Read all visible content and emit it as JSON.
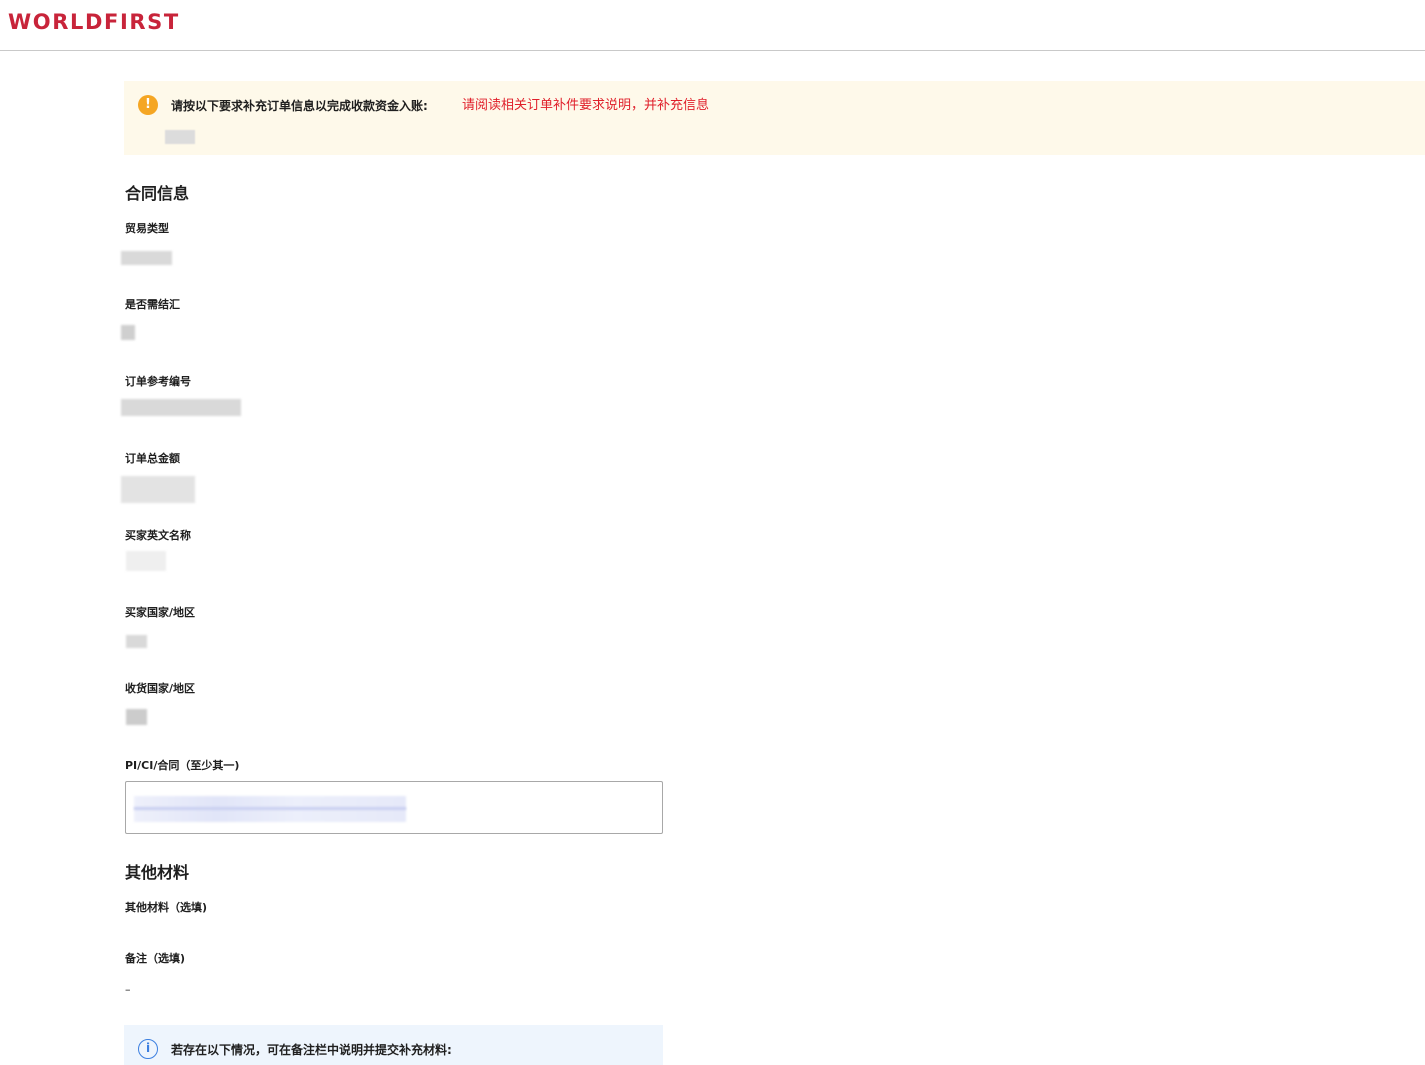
{
  "header": {
    "logo_text": "WORLDFIRST"
  },
  "notice": {
    "icon": "exclamation-circle-icon",
    "text": "请按以下要求补充订单信息以完成收款资金入账:",
    "link_text": "请阅读相关订单补件要求说明，并补充信息"
  },
  "contract": {
    "title": "合同信息",
    "fields": [
      {
        "label": "贸易类型"
      },
      {
        "label": "是否需结汇"
      },
      {
        "label": "订单参考编号"
      },
      {
        "label": "订单总金额"
      },
      {
        "label": "买家英文名称"
      },
      {
        "label": "买家国家/地区"
      },
      {
        "label": "收货国家/地区"
      },
      {
        "label": "PI/CI/合同（至少其一)"
      }
    ]
  },
  "other": {
    "title": "其他材料",
    "materials_label": "其他材料（选填)",
    "remark_label": "备注（选填)",
    "remark_value": "–"
  },
  "info": {
    "icon": "info-circle-icon",
    "text": "若存在以下情况，可在备注栏中说明并提交补充材料:"
  },
  "colors": {
    "brand": "#c8243a",
    "warning_bg": "#fef9ea",
    "warning_icon": "#f5a623",
    "link_red": "#e0202b",
    "info_bg": "#eef5fd",
    "info_icon": "#3c7fe0"
  }
}
